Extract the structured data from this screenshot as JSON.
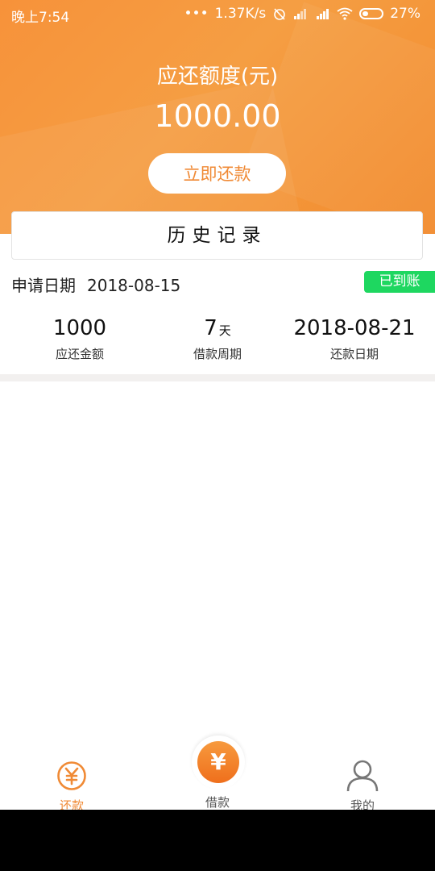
{
  "status_bar": {
    "time": "晚上7:54",
    "dots": "•••",
    "speed": "1.37K/s",
    "battery": "27%"
  },
  "hero": {
    "title": "应还额度(元)",
    "amount": "1000.00",
    "repay_button": "立即还款"
  },
  "history": {
    "header": "历史记录",
    "record": {
      "apply_label": "申请日期",
      "apply_date": "2018-08-15",
      "status": "已到账",
      "amount_value": "1000",
      "amount_label": "应还金额",
      "period_value": "7",
      "period_unit": "天",
      "period_label": "借款周期",
      "repay_date_value": "2018-08-21",
      "repay_date_label": "还款日期"
    }
  },
  "tabbar": {
    "repay": "还款",
    "borrow": "借款",
    "borrow_symbol": "¥",
    "mine": "我的"
  },
  "colors": {
    "accent": "#f08a35",
    "status_green": "#1ed760"
  }
}
